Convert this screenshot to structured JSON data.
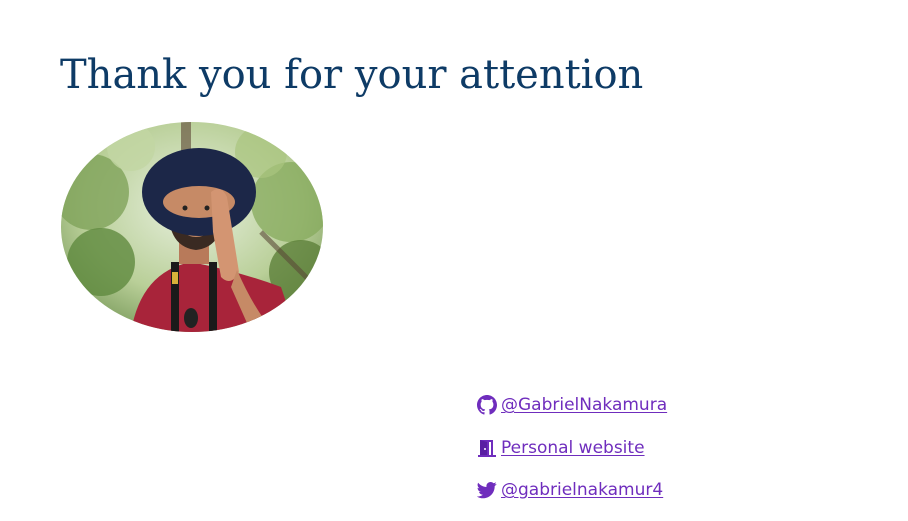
{
  "slide": {
    "title": "Thank you for your attention"
  },
  "links": [
    {
      "icon": "github-icon",
      "label": "@GabrielNakamura"
    },
    {
      "icon": "door-icon",
      "label": "Personal website"
    },
    {
      "icon": "twitter-icon",
      "label": "@gabrielnakamur4"
    }
  ],
  "colors": {
    "title": "#0e3b66",
    "link": "#6f2dbd"
  }
}
